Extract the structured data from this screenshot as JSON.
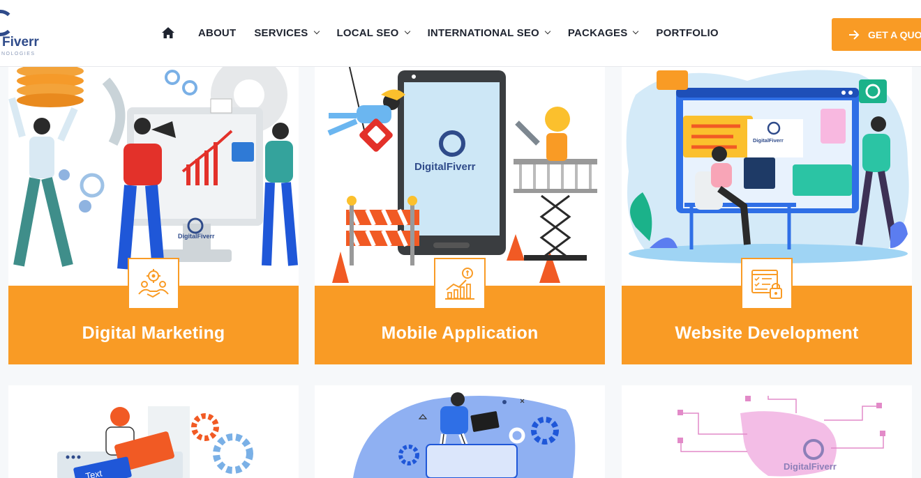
{
  "brand": {
    "name": "Fiverr",
    "tagline": "NOLOGIES",
    "logo_word": "DigitalFiverr"
  },
  "nav": {
    "home_icon": "home-icon",
    "items": [
      {
        "label": "ABOUT",
        "dropdown": false
      },
      {
        "label": "SERVICES",
        "dropdown": true
      },
      {
        "label": "LOCAL SEO",
        "dropdown": true
      },
      {
        "label": "INTERNATIONAL SEO",
        "dropdown": true
      },
      {
        "label": "PACKAGES",
        "dropdown": true
      },
      {
        "label": "PORTFOLIO",
        "dropdown": false
      }
    ]
  },
  "cta": {
    "label": "GET A QUO",
    "icon": "arrow-right-icon"
  },
  "services": [
    {
      "title": "Digital Marketing",
      "icon": "team-gear-icon"
    },
    {
      "title": "Mobile Application",
      "icon": "growth-chart-icon"
    },
    {
      "title": "Website Development",
      "icon": "secure-document-icon"
    }
  ],
  "illustration_text": {
    "text_label": "Text"
  },
  "colors": {
    "accent": "#f99b25",
    "nav_text": "#1f2430",
    "brand_blue": "#2f4b8a"
  }
}
